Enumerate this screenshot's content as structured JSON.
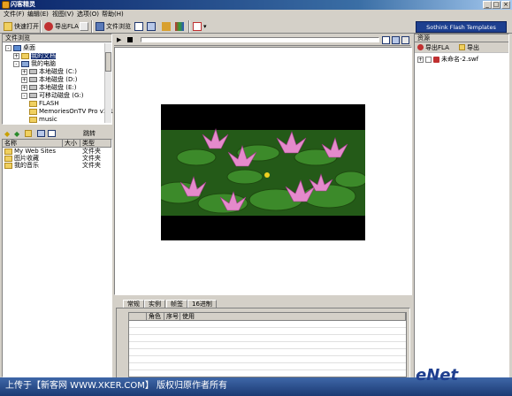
{
  "window": {
    "title": "闪客精灵"
  },
  "menu": [
    "文件(F)",
    "编辑(E)",
    "视图(V)",
    "选项(O)",
    "帮助(H)"
  ],
  "toolbar": {
    "quick_open": "快速打开",
    "export_fla": "导出FLA",
    "file_browse": "文件浏览",
    "sothink_button": "Sothink Flash Templates"
  },
  "file_browser": {
    "title": "文件浏览",
    "tree": [
      {
        "label": "桌面",
        "indent": 0,
        "expander": "-",
        "icon": "desktop-icon"
      },
      {
        "label": "我的文档",
        "indent": 1,
        "expander": "+",
        "icon": "folder-icon",
        "selected": true
      },
      {
        "label": "我的电脑",
        "indent": 1,
        "expander": "-",
        "icon": "computer-icon"
      },
      {
        "label": "本地磁盘 (C:)",
        "indent": 2,
        "expander": "+",
        "icon": "drive-icon"
      },
      {
        "label": "本地磁盘 (D:)",
        "indent": 2,
        "expander": "+",
        "icon": "drive-icon"
      },
      {
        "label": "本地磁盘 (E:)",
        "indent": 2,
        "expander": "+",
        "icon": "drive-icon"
      },
      {
        "label": "可移动磁盘 (G:)",
        "indent": 2,
        "expander": "-",
        "icon": "drive-icon"
      },
      {
        "label": "FLASH",
        "indent": 3,
        "expander": "",
        "icon": "folder-icon"
      },
      {
        "label": "MemoriesOnTV Pro v3.1",
        "indent": 3,
        "expander": "",
        "icon": "folder-icon"
      },
      {
        "label": "music",
        "indent": 3,
        "expander": "",
        "icon": "folder-icon"
      }
    ]
  },
  "file_list": {
    "browse_label": "跳转",
    "columns": [
      "名称",
      "大小",
      "类型"
    ],
    "rows": [
      {
        "name": "My Web Sites",
        "size": "",
        "type": "文件夹"
      },
      {
        "name": "图片收藏",
        "size": "",
        "type": "文件夹"
      },
      {
        "name": "我的音乐",
        "size": "",
        "type": "文件夹"
      }
    ]
  },
  "resources": {
    "title": "资源",
    "export_fla": "导出FLA",
    "export": "导出",
    "tree_item": "未命名-2.swf"
  },
  "bottom_panel": {
    "tabs": [
      "常规",
      "实例",
      "帧签",
      "16进制"
    ],
    "columns": [
      "角色",
      "序号",
      "使用"
    ]
  },
  "watermark": {
    "text": "上传于【新客网 WWW.XKER.COM】 版权归原作者所有",
    "brand": "eNet"
  },
  "colors": {
    "titlebar": "#0a246a",
    "sothink_button": "#1d3f8f",
    "watermark_bar": "#2c5597"
  }
}
